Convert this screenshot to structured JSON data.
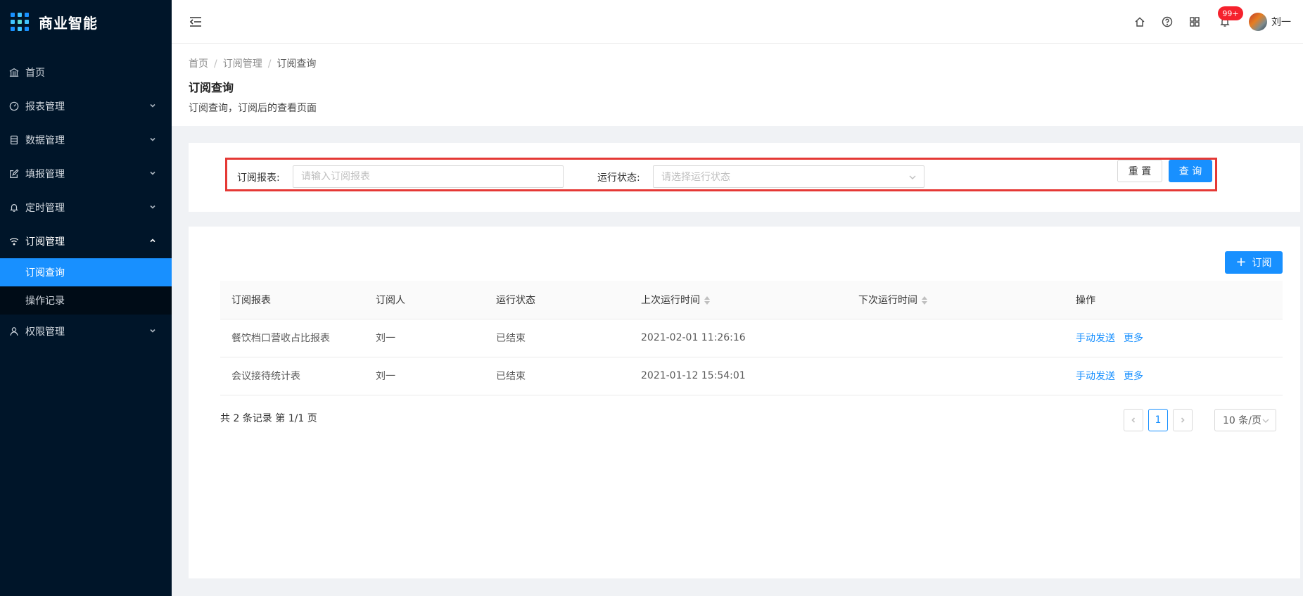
{
  "app": {
    "title": "商业智能"
  },
  "sidebar": {
    "items": [
      {
        "label": "首页",
        "icon": "bank-icon"
      },
      {
        "label": "报表管理",
        "icon": "dashboard-icon"
      },
      {
        "label": "数据管理",
        "icon": "database-icon"
      },
      {
        "label": "填报管理",
        "icon": "form-edit-icon"
      },
      {
        "label": "定时管理",
        "icon": "bell-icon"
      },
      {
        "label": "订阅管理",
        "icon": "wifi-icon",
        "open": true,
        "children": [
          {
            "label": "订阅查询",
            "active": true
          },
          {
            "label": "操作记录"
          }
        ]
      },
      {
        "label": "权限管理",
        "icon": "user-icon"
      }
    ]
  },
  "header": {
    "icons": [
      "home-icon",
      "help-icon",
      "apps-icon",
      "bell-icon"
    ],
    "notification_badge": "99+",
    "username": "刘一"
  },
  "breadcrumb": [
    "首页",
    "订阅管理",
    "订阅查询"
  ],
  "page": {
    "title": "订阅查询",
    "description": "订阅查询，订阅后的查看页面"
  },
  "search": {
    "report_label": "订阅报表:",
    "report_placeholder": "请输入订阅报表",
    "status_label": "运行状态:",
    "status_placeholder": "请选择运行状态",
    "reset_label": "重 置",
    "query_label": "查 询"
  },
  "table": {
    "add_label": "订阅",
    "columns": [
      "订阅报表",
      "订阅人",
      "运行状态",
      "上次运行时间",
      "下次运行时间",
      "操作"
    ],
    "rows": [
      {
        "report": "餐饮档口营收占比报表",
        "subscriber": "刘一",
        "status": "已结束",
        "last_run": "2021-02-01 11:26:16",
        "next_run": "",
        "actions": [
          "手动发送",
          "更多"
        ]
      },
      {
        "report": "会议接待统计表",
        "subscriber": "刘一",
        "status": "已结束",
        "last_run": "2021-01-12 15:54:01",
        "next_run": "",
        "actions": [
          "手动发送",
          "更多"
        ]
      }
    ]
  },
  "pagination": {
    "total_text": "共 2 条记录 第 1/1 页",
    "current_page": "1",
    "page_size": "10 条/页"
  },
  "colors": {
    "sidebar_bg": "#001529",
    "accent": "#1890ff",
    "highlight_border": "#e53935",
    "badge": "#f5222d"
  }
}
